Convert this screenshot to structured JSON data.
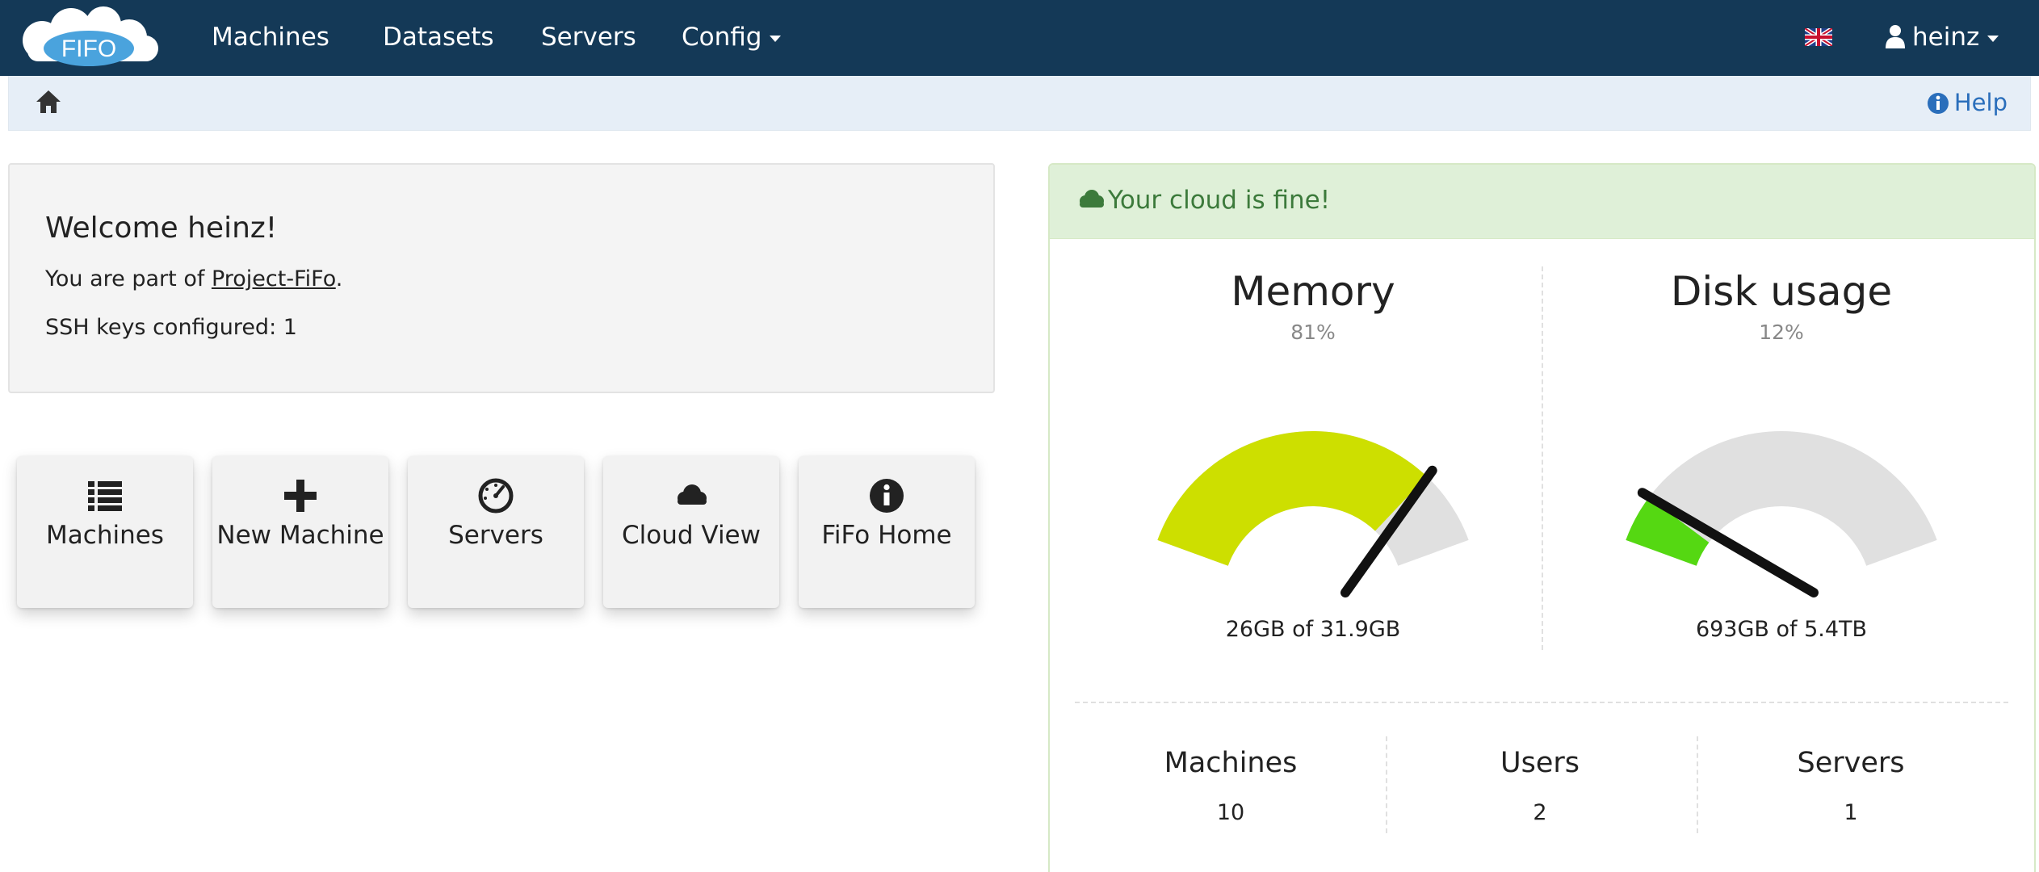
{
  "navbar": {
    "logo_text": "FIFO",
    "items": [
      "Machines",
      "Datasets",
      "Servers",
      "Config"
    ],
    "user": "heinz"
  },
  "breadcrumb": {
    "help_label": "Help"
  },
  "welcome": {
    "title": "Welcome heinz!",
    "part_prefix": "You are part of ",
    "org": "Project-FiFo",
    "part_suffix": ".",
    "ssh_label": "SSH keys configured: 1"
  },
  "tiles": [
    {
      "label": "Machines",
      "icon": "list-icon"
    },
    {
      "label": "New Machine",
      "icon": "plus-icon"
    },
    {
      "label": "Servers",
      "icon": "dashboard-icon"
    },
    {
      "label": "Cloud View",
      "icon": "cloud-icon"
    },
    {
      "label": "FiFo Home",
      "icon": "info-icon"
    }
  ],
  "status": {
    "message": "Your cloud is fine!",
    "gauges": [
      {
        "title": "Memory",
        "percent_label": "81%",
        "value": 81,
        "caption": "26GB of 31.9GB",
        "color": "#cddf00"
      },
      {
        "title": "Disk usage",
        "percent_label": "12%",
        "value": 12,
        "caption": "693GB of 5.4TB",
        "color": "#55d812"
      }
    ],
    "stats": [
      {
        "label": "Machines",
        "value": "10"
      },
      {
        "label": "Users",
        "value": "2"
      },
      {
        "label": "Servers",
        "value": "1"
      }
    ]
  },
  "colors": {
    "navbar": "#143957",
    "breadcrumb": "#e6eef7",
    "success_bg": "#dff0d8",
    "success_text": "#3c7a3b",
    "link": "#2a6ebb",
    "gauge_track": "#e0e0e0",
    "needle": "#111111"
  }
}
